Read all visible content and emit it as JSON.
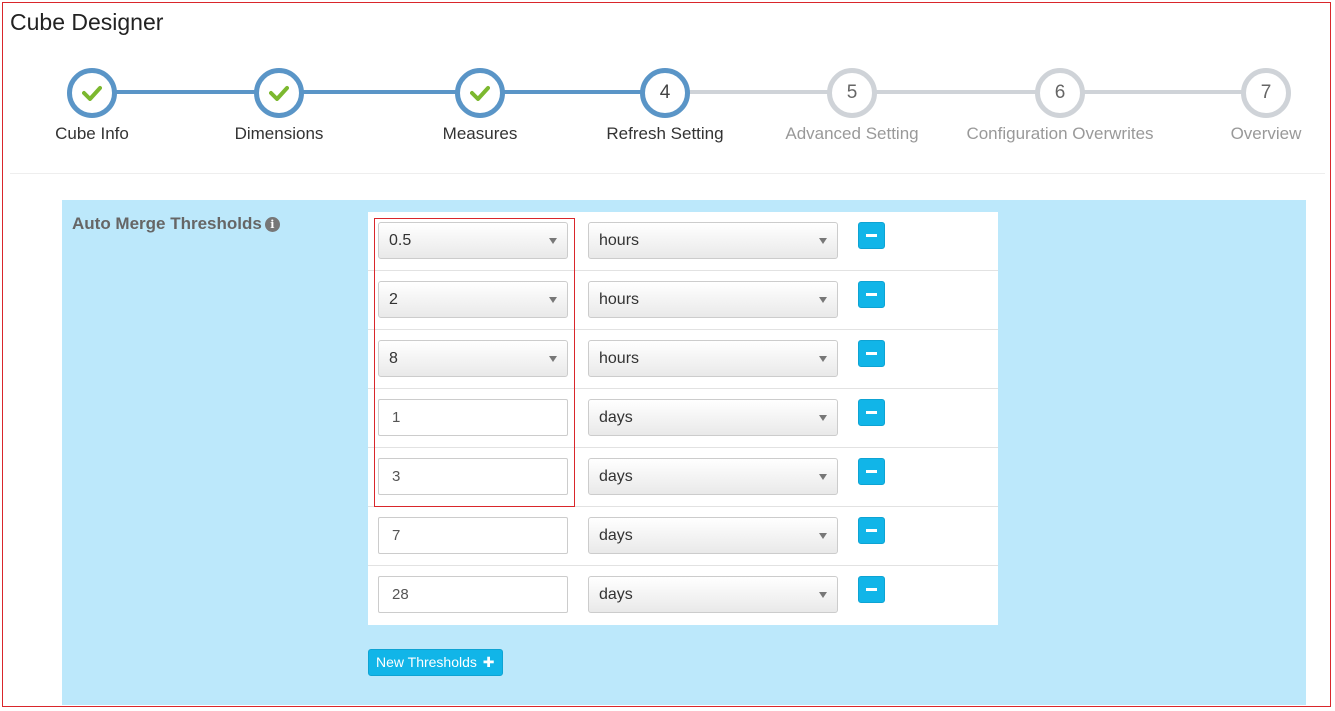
{
  "app": {
    "title": "Cube Designer"
  },
  "wizard": {
    "steps": [
      {
        "number": "1",
        "label": "Cube Info",
        "state": "done"
      },
      {
        "number": "2",
        "label": "Dimensions",
        "state": "done"
      },
      {
        "number": "3",
        "label": "Measures",
        "state": "done"
      },
      {
        "number": "4",
        "label": "Refresh Setting",
        "state": "current"
      },
      {
        "number": "5",
        "label": "Advanced Setting",
        "state": "todo"
      },
      {
        "number": "6",
        "label": "Configuration Overwrites",
        "state": "todo"
      },
      {
        "number": "7",
        "label": "Overview",
        "state": "todo"
      }
    ]
  },
  "thresholds": {
    "label": "Auto Merge Thresholds",
    "info_icon": "info-circle-icon",
    "rows": [
      {
        "value": "0.5",
        "value_kind": "select",
        "unit": "hours"
      },
      {
        "value": "2",
        "value_kind": "select",
        "unit": "hours"
      },
      {
        "value": "8",
        "value_kind": "select",
        "unit": "hours"
      },
      {
        "value": "1",
        "value_kind": "input",
        "unit": "days"
      },
      {
        "value": "3",
        "value_kind": "input",
        "unit": "days"
      },
      {
        "value": "7",
        "value_kind": "input",
        "unit": "days"
      },
      {
        "value": "28",
        "value_kind": "input",
        "unit": "days"
      }
    ],
    "new_button_label": "New Thresholds",
    "new_button_icon": "plus-icon",
    "remove_icon": "minus-icon"
  },
  "colors": {
    "accent": "#11b5e8",
    "step_done": "#5a95c7",
    "step_todo": "#cfd3d8",
    "check": "#7cb82f",
    "panel_bg": "#bce8fb",
    "annotation_border": "#d9262b"
  }
}
